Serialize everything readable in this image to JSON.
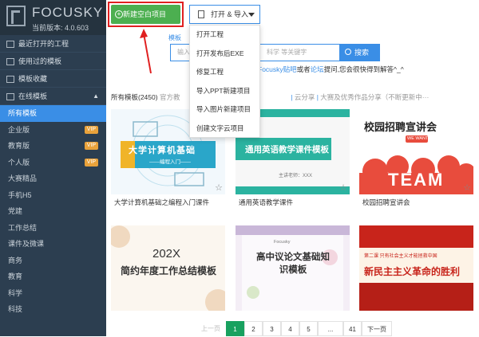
{
  "app": {
    "name": "FOCUSKY",
    "version": "当前版本: 4.0.603"
  },
  "sidebar": {
    "items": [
      {
        "label": "最近打开的工程"
      },
      {
        "label": "使用过的模板"
      },
      {
        "label": "模板收藏"
      },
      {
        "label": "在线模板"
      }
    ],
    "subitems": [
      {
        "label": "所有模板"
      },
      {
        "label": "企业版",
        "badge": "VIP"
      },
      {
        "label": "教育版",
        "badge": "VIP"
      },
      {
        "label": "个人版",
        "badge": "VIP"
      },
      {
        "label": "大赛精品"
      },
      {
        "label": "手机H5"
      },
      {
        "label": "党建"
      },
      {
        "label": "工作总结"
      },
      {
        "label": "课件及微课"
      },
      {
        "label": "商务"
      },
      {
        "label": "教育"
      },
      {
        "label": "科学"
      },
      {
        "label": "科技"
      }
    ]
  },
  "toolbar": {
    "new_label": "新建空白项目",
    "open_label": "打开 & 导入"
  },
  "menu": {
    "items": [
      "打开工程",
      "打开发布后EXE",
      "修复工程",
      "导入PPT新建项目",
      "导入图片新建项目",
      "创建文字云项目"
    ]
  },
  "search": {
    "tab_label": "模板",
    "placeholder": "输入",
    "placeholder_tail": "科学 等关键字",
    "button": "搜索"
  },
  "help": {
    "link1": "Focusky贴吧",
    "mid": "或者",
    "link2": "论坛",
    "tail": "提问,您会很快得到解答^_^"
  },
  "filter": {
    "all": "所有模板(2450)",
    "mid": "官方教",
    "rest": "云分享",
    "tail": "大赛及优秀作品分享（不断更新中···"
  },
  "cards": [
    {
      "title": "大学计算机基础之编程入门课件",
      "thumb_text": "大学计算机基础",
      "thumb_sub": "——编程入门——"
    },
    {
      "title": "通用英语教学课件",
      "thumb_text": "通用英语教学课件模板",
      "thumb_sub": "主讲老师：XXX"
    },
    {
      "title": "校园招聘宣讲会",
      "thumb_text": "校园招聘宣讲会",
      "thumb_sub": "WE WANT YOU"
    },
    {
      "title": "",
      "thumb_text": "简约年度工作总结模板",
      "thumb_sub": "202X"
    },
    {
      "title": "",
      "thumb_text": "高中议论文基础知识模板",
      "thumb_sub": "Focusky"
    },
    {
      "title": "",
      "thumb_text": "新民主主义革命的胜利",
      "thumb_sub": "第二课 只有社会主义才能拯救中国"
    }
  ],
  "pager": {
    "prev": "上一页",
    "pages": [
      "1",
      "2",
      "3",
      "4",
      "5",
      "...",
      "41"
    ],
    "next": "下一页",
    "current": "1"
  },
  "colors": {
    "sidebar": "#2c3e50",
    "accent": "#3a8ee6",
    "new_button": "#4caf50",
    "highlight": "#e02020",
    "vip": "#e9a23b"
  }
}
